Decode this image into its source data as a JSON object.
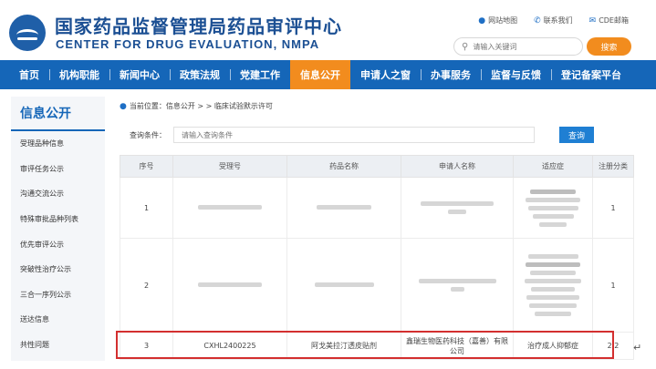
{
  "header": {
    "title_cn": "国家药品监督管理局药品审评中心",
    "title_en": "CENTER FOR DRUG EVALUATION, NMPA",
    "logo_icon": "cde-logo-icon",
    "links": [
      {
        "label": "网站地图",
        "icon": "location-pin-icon",
        "glyph": "●"
      },
      {
        "label": "联系我们",
        "icon": "phone-icon",
        "glyph": "✆"
      },
      {
        "label": "CDE邮箱",
        "icon": "mail-icon",
        "glyph": "✉"
      }
    ],
    "search_placeholder": "请输入关键词",
    "search_button": "搜索"
  },
  "nav": {
    "items": [
      "首页",
      "机构职能",
      "新闻中心",
      "政策法规",
      "党建工作",
      "信息公开",
      "申请人之窗",
      "办事服务",
      "监督与反馈",
      "登记备案平台"
    ],
    "active_index": 5,
    "color": "#1566b8",
    "active_color": "#f28c1e"
  },
  "sidebar": {
    "title": "信息公开",
    "items": [
      "受理品种信息",
      "审评任务公示",
      "沟通交流公示",
      "特殊审批品种列表",
      "优先审评公示",
      "突破性治疗公示",
      "三合一序列公示",
      "送达信息",
      "共性问题"
    ]
  },
  "breadcrumb": "当前位置：信息公开 > > 临床试验默示许可",
  "query": {
    "label": "查询条件：",
    "placeholder": "请输入查询条件",
    "button": "查询"
  },
  "table": {
    "headers": [
      "序号",
      "受理号",
      "药品名称",
      "申请人名称",
      "适应症",
      "注册分类"
    ],
    "rows": [
      {
        "no": "1",
        "acceptance_no": "",
        "drug_name": "",
        "applicant": "",
        "indication": "",
        "category": "1"
      },
      {
        "no": "2",
        "acceptance_no": "",
        "drug_name": "",
        "applicant": "",
        "indication": "",
        "category": "1"
      },
      {
        "no": "3",
        "acceptance_no": "CXHL2400225",
        "drug_name": "阿戈美拉汀透皮贴剂",
        "applicant": "鑫瑞生物医药科技（嘉善）有限公司",
        "indication": "治疗成人抑郁症",
        "category": "2.2"
      }
    ]
  },
  "highlight_color": "#d32f2f",
  "return_mark": "↵"
}
